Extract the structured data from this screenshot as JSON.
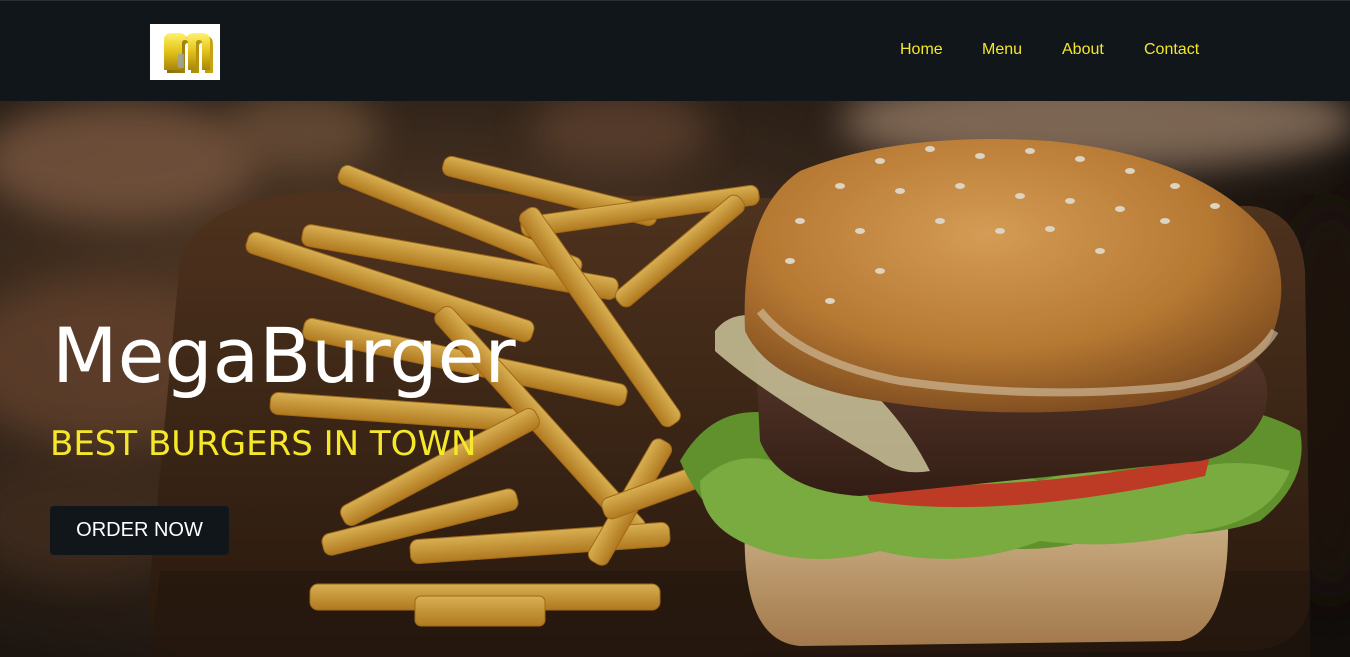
{
  "nav": {
    "logo_icon": "megaburger-logo-m",
    "links": [
      {
        "label": "Home"
      },
      {
        "label": "Menu"
      },
      {
        "label": "About"
      },
      {
        "label": "Contact"
      }
    ]
  },
  "hero": {
    "title": "MegaBurger",
    "tagline": "BEST BURGERS IN TOWN",
    "cta_label": "ORDER NOW"
  },
  "colors": {
    "nav_bg": "#11161b",
    "accent_yellow": "#f5e82a",
    "button_bg": "#11161b",
    "title_white": "#ffffff"
  }
}
